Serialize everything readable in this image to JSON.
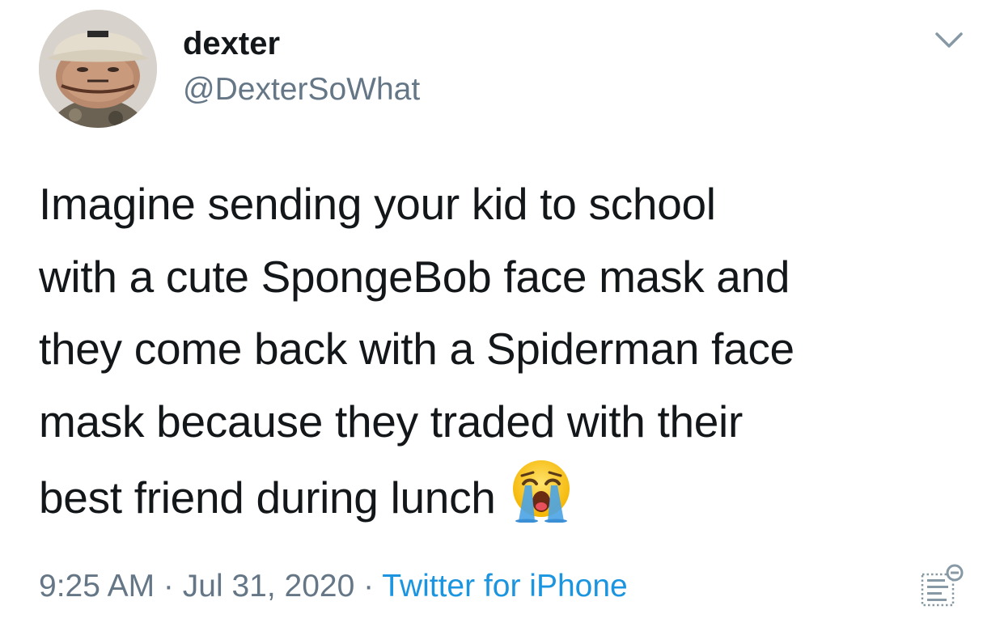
{
  "tweet": {
    "author": {
      "display_name": "dexter",
      "handle": "@DexterSoWhat",
      "avatar_icon": "profile-photo"
    },
    "text_lines": [
      "Imagine sending your kid to school",
      "with a cute SpongeBob face mask and",
      "they come back with a Spiderman face",
      "mask because they traded with their",
      "best friend during lunch"
    ],
    "emoji": "loudly-crying-face",
    "time": "9:25 AM",
    "separator": " · ",
    "date": "Jul 31, 2020",
    "source": "Twitter for iPhone",
    "menu_icon": "chevron-down-icon",
    "analytics_icon": "analytics-icon"
  },
  "colors": {
    "text": "#14171a",
    "secondary": "#657786",
    "link": "#1b95e0"
  }
}
